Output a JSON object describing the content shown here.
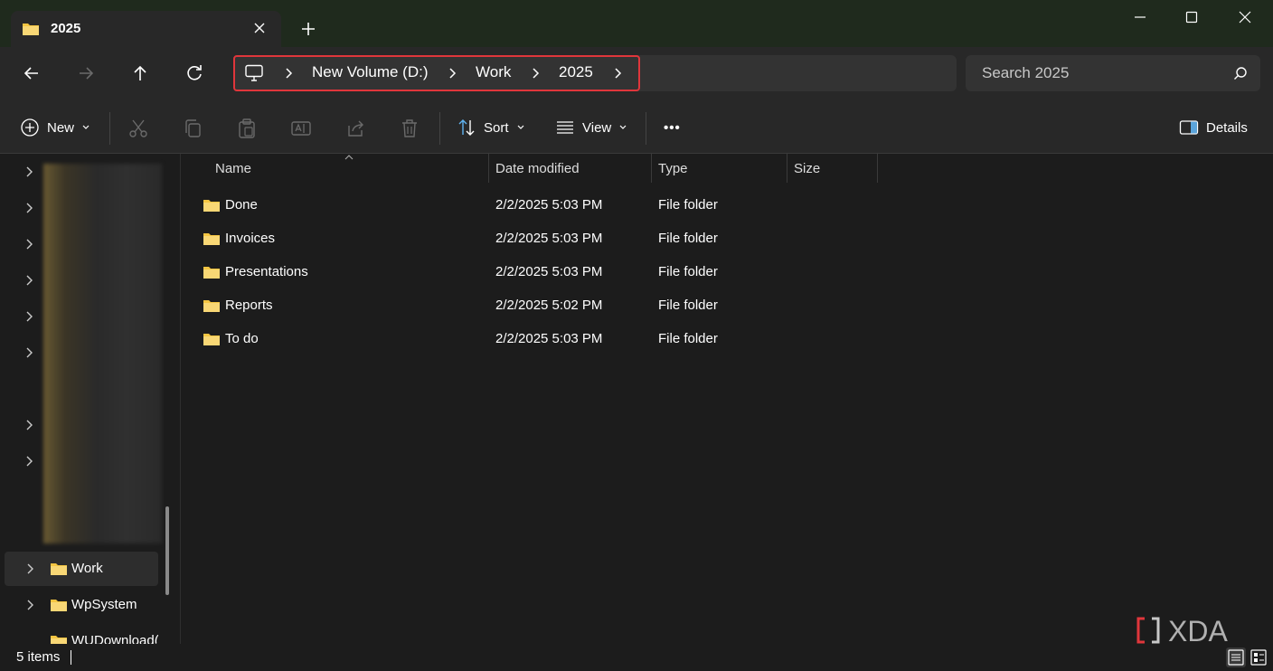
{
  "window": {
    "tab_title": "2025",
    "new_tab_label": "+"
  },
  "address": {
    "crumbs": [
      "New Volume (D:)",
      "Work",
      "2025"
    ],
    "search_placeholder": "Search 2025"
  },
  "commands": {
    "new_label": "New",
    "sort_label": "Sort",
    "view_label": "View",
    "more_label": "•••",
    "details_label": "Details"
  },
  "nav": {
    "items": [
      {
        "label": "Work",
        "selected": true
      },
      {
        "label": "WpSystem",
        "selected": false
      },
      {
        "label": "WUDownload(",
        "selected": false
      }
    ]
  },
  "list": {
    "columns": [
      "Name",
      "Date modified",
      "Type",
      "Size"
    ],
    "rows": [
      {
        "name": "Done",
        "date": "2/2/2025 5:03 PM",
        "type": "File folder",
        "size": ""
      },
      {
        "name": "Invoices",
        "date": "2/2/2025 5:03 PM",
        "type": "File folder",
        "size": ""
      },
      {
        "name": "Presentations",
        "date": "2/2/2025 5:03 PM",
        "type": "File folder",
        "size": ""
      },
      {
        "name": "Reports",
        "date": "2/2/2025 5:02 PM",
        "type": "File folder",
        "size": ""
      },
      {
        "name": "To do",
        "date": "2/2/2025 5:03 PM",
        "type": "File folder",
        "size": ""
      }
    ]
  },
  "status": {
    "item_count": "5 items"
  },
  "watermark": "XDA",
  "colors": {
    "highlight_frame": "#e0363b",
    "folder_yellow": "#f4c542",
    "accent_blue": "#60b3f0"
  }
}
